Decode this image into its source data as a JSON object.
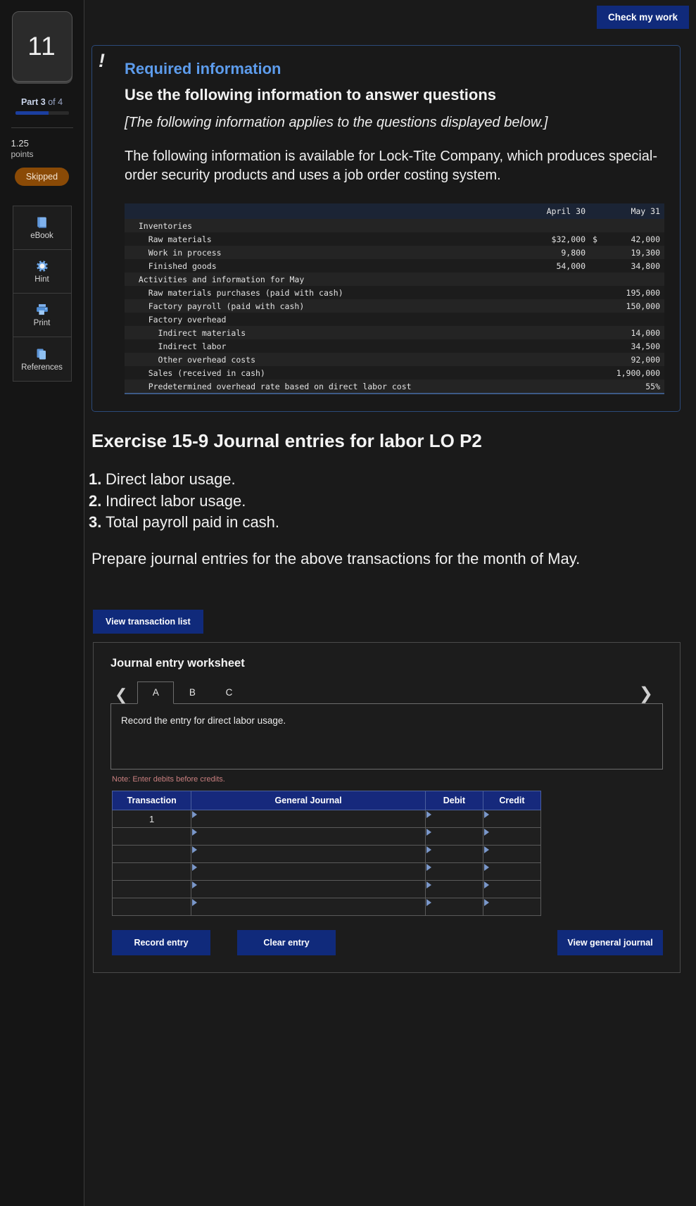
{
  "sidebar": {
    "question_number": "11",
    "part_prefix": "Part",
    "part_current": "3",
    "part_of": "of 4",
    "points_value": "1.25",
    "points_label": "points",
    "status_badge": "Skipped",
    "tools": [
      {
        "label": "eBook",
        "icon": "book-icon"
      },
      {
        "label": "Hint",
        "icon": "lifesaver-icon"
      },
      {
        "label": "Print",
        "icon": "printer-icon"
      },
      {
        "label": "References",
        "icon": "copy-pages-icon"
      }
    ]
  },
  "topbar": {
    "check_button": "Check my work"
  },
  "required_info": {
    "alert_icon": "exclamation-icon",
    "title": "Required information",
    "subtitle": "Use the following information to answer questions",
    "italic_note": "[The following information applies to the questions displayed below.]",
    "body": "The following information is available for Lock-Tite Company, which produces special-order security products and uses a job order costing system.",
    "table": {
      "columns": [
        "",
        "April 30",
        "May 31"
      ],
      "rows": [
        {
          "label": "Inventories",
          "indent": 0,
          "april": "",
          "may_cur": "",
          "may": "",
          "shade": "alt"
        },
        {
          "label": "Raw materials",
          "indent": 1,
          "april": "$32,000",
          "may_cur": "$",
          "may": "42,000",
          "shade": "plain"
        },
        {
          "label": "Work in process",
          "indent": 1,
          "april": "9,800",
          "may_cur": "",
          "may": "19,300",
          "shade": "alt"
        },
        {
          "label": "Finished goods",
          "indent": 1,
          "april": "54,000",
          "may_cur": "",
          "may": "34,800",
          "shade": "plain"
        },
        {
          "label": "Activities and information for May",
          "indent": 0,
          "april": "",
          "may_cur": "",
          "may": "",
          "shade": "alt"
        },
        {
          "label": "Raw materials purchases (paid with cash)",
          "indent": 1,
          "april": "",
          "may_cur": "",
          "may": "195,000",
          "shade": "plain"
        },
        {
          "label": "Factory payroll (paid with cash)",
          "indent": 1,
          "april": "",
          "may_cur": "",
          "may": "150,000",
          "shade": "alt"
        },
        {
          "label": "Factory overhead",
          "indent": 1,
          "april": "",
          "may_cur": "",
          "may": "",
          "shade": "plain"
        },
        {
          "label": "Indirect materials",
          "indent": 2,
          "april": "",
          "may_cur": "",
          "may": "14,000",
          "shade": "alt"
        },
        {
          "label": "Indirect labor",
          "indent": 2,
          "april": "",
          "may_cur": "",
          "may": "34,500",
          "shade": "plain"
        },
        {
          "label": "Other overhead costs",
          "indent": 2,
          "april": "",
          "may_cur": "",
          "may": "92,000",
          "shade": "alt"
        },
        {
          "label": "Sales (received in cash)",
          "indent": 1,
          "april": "",
          "may_cur": "",
          "may": "1,900,000",
          "shade": "plain"
        },
        {
          "label": "Predetermined overhead rate based on direct labor cost",
          "indent": 1,
          "april": "",
          "may_cur": "",
          "may": "55%",
          "shade": "alt"
        }
      ]
    }
  },
  "exercise": {
    "title": "Exercise 15-9 Journal entries for labor LO P2",
    "items": [
      {
        "n": "1.",
        "text": "Direct labor usage."
      },
      {
        "n": "2.",
        "text": "Indirect labor usage."
      },
      {
        "n": "3.",
        "text": "Total payroll paid in cash."
      }
    ],
    "prompt": "Prepare journal entries for the above transactions for the month of May."
  },
  "transaction_list_button": "View transaction list",
  "worksheet": {
    "title": "Journal entry worksheet",
    "prev_icon": "chevron-left-icon",
    "next_icon": "chevron-right-icon",
    "tabs": [
      {
        "label": "A",
        "active": true
      },
      {
        "label": "B",
        "active": false
      },
      {
        "label": "C",
        "active": false
      }
    ],
    "prompt": "Record the entry for direct labor usage.",
    "note": "Note: Enter debits before credits.",
    "table": {
      "headers": [
        "Transaction",
        "General Journal",
        "Debit",
        "Credit"
      ],
      "rows": [
        {
          "transaction": "1",
          "general_journal": "",
          "debit": "",
          "credit": ""
        },
        {
          "transaction": "",
          "general_journal": "",
          "debit": "",
          "credit": ""
        },
        {
          "transaction": "",
          "general_journal": "",
          "debit": "",
          "credit": ""
        },
        {
          "transaction": "",
          "general_journal": "",
          "debit": "",
          "credit": ""
        },
        {
          "transaction": "",
          "general_journal": "",
          "debit": "",
          "credit": ""
        },
        {
          "transaction": "",
          "general_journal": "",
          "debit": "",
          "credit": ""
        }
      ]
    },
    "actions": {
      "record": "Record entry",
      "clear": "Clear entry",
      "view_general_journal": "View general journal"
    }
  },
  "colors": {
    "accent_blue": "#102a7b",
    "header_blue": "#16297c",
    "title_blue": "#5d9cec",
    "skipped_orange": "#8a4a06",
    "note_red": "#c97f7f"
  }
}
